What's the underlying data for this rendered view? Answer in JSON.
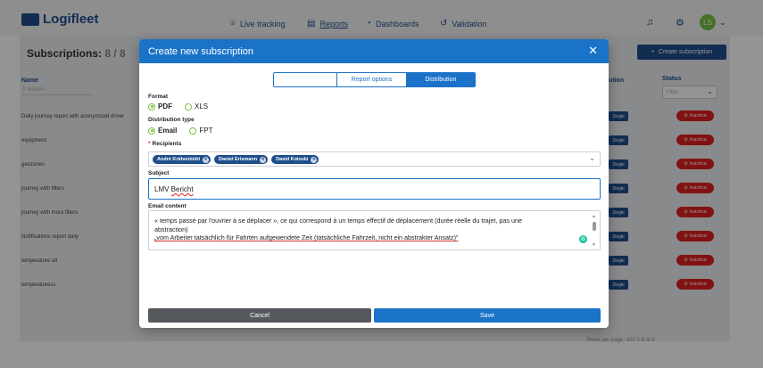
{
  "app": {
    "logo_text": "Logifleet",
    "nav": [
      {
        "label": "Live tracking",
        "icon": "location-pin-icon"
      },
      {
        "label": "Reports",
        "icon": "document-icon"
      },
      {
        "label": "Dashboards",
        "icon": "dashboard-icon"
      },
      {
        "label": "Validation",
        "icon": "history-icon"
      }
    ],
    "avatar_initials": "LS",
    "subscriptions_title": "Subscriptions:",
    "subscriptions_count": "8 / 8",
    "create_button_label": "Create subscription",
    "columns": {
      "name": "Name",
      "name_search_placeholder": "Search",
      "distribution": "ution",
      "status": "Status",
      "status_filter_placeholder": "Filter"
    },
    "rows": [
      {
        "name": "Daily journey report with anonymized driver",
        "dist": "Ziegle",
        "status": "Inactive"
      },
      {
        "name": "equipment",
        "dist": "Ziegle",
        "status": "Inactive"
      },
      {
        "name": "geozones",
        "dist": "Ziegle",
        "status": "Inactive"
      },
      {
        "name": "journey with filters",
        "dist": "Ziegle",
        "status": "Inactive"
      },
      {
        "name": "journey with more filters",
        "dist": "Ziegle",
        "status": "Inactive"
      },
      {
        "name": "Notifications report daily",
        "dist": "Ziegle",
        "status": "Inactive"
      },
      {
        "name": "temperature all",
        "dist": "Ziegle",
        "status": "Inactive"
      },
      {
        "name": "temperaturess",
        "dist": "Ziegle",
        "status": "Inactive"
      }
    ],
    "footer_text": "Rows per page: 100    1-8 of 8"
  },
  "modal": {
    "title": "Create new subscription",
    "close_symbol": "✕",
    "tabs": [
      {
        "label": "",
        "active": false
      },
      {
        "label": "Report options",
        "active": false
      },
      {
        "label": "Distribution",
        "active": true
      }
    ],
    "format": {
      "label": "Format",
      "options": [
        {
          "label": "PDF",
          "selected": true
        },
        {
          "label": "XLS",
          "selected": false
        }
      ]
    },
    "distribution_type": {
      "label": "Distribution type",
      "options": [
        {
          "label": "Email",
          "selected": true
        },
        {
          "label": "FPT",
          "selected": false
        }
      ]
    },
    "recipients": {
      "label": "Recipients",
      "required_mark": "*",
      "chips": [
        "André Krähenbühl",
        "Daniel Erismann",
        "David Koloski"
      ]
    },
    "subject": {
      "label": "Subject",
      "value_plain": "LMV ",
      "value_flagged": "Bericht"
    },
    "email_content": {
      "label": "Email content",
      "line1": "« temps passé par l'ouvrier à se déplacer », ce qui correspond à un temps effectif de déplacement (durée réelle du trajet, pas une",
      "line2": "abstraction)",
      "line3": "„vom Arbeiter tatsächlich für Fahrten aufgewendete Zeit (tatsächliche Fahrzeit, nicht ein abstrakter Ansatz)\"",
      "grammarly_badge": "G"
    },
    "cancel_label": "Cancel",
    "save_label": "Save"
  },
  "colors": {
    "header_blue": "#1a73c8",
    "brand_navy": "#1f4e8c",
    "radio_green": "#7cc242",
    "inactive_red": "#e02020",
    "cancel_gray": "#55595e"
  }
}
